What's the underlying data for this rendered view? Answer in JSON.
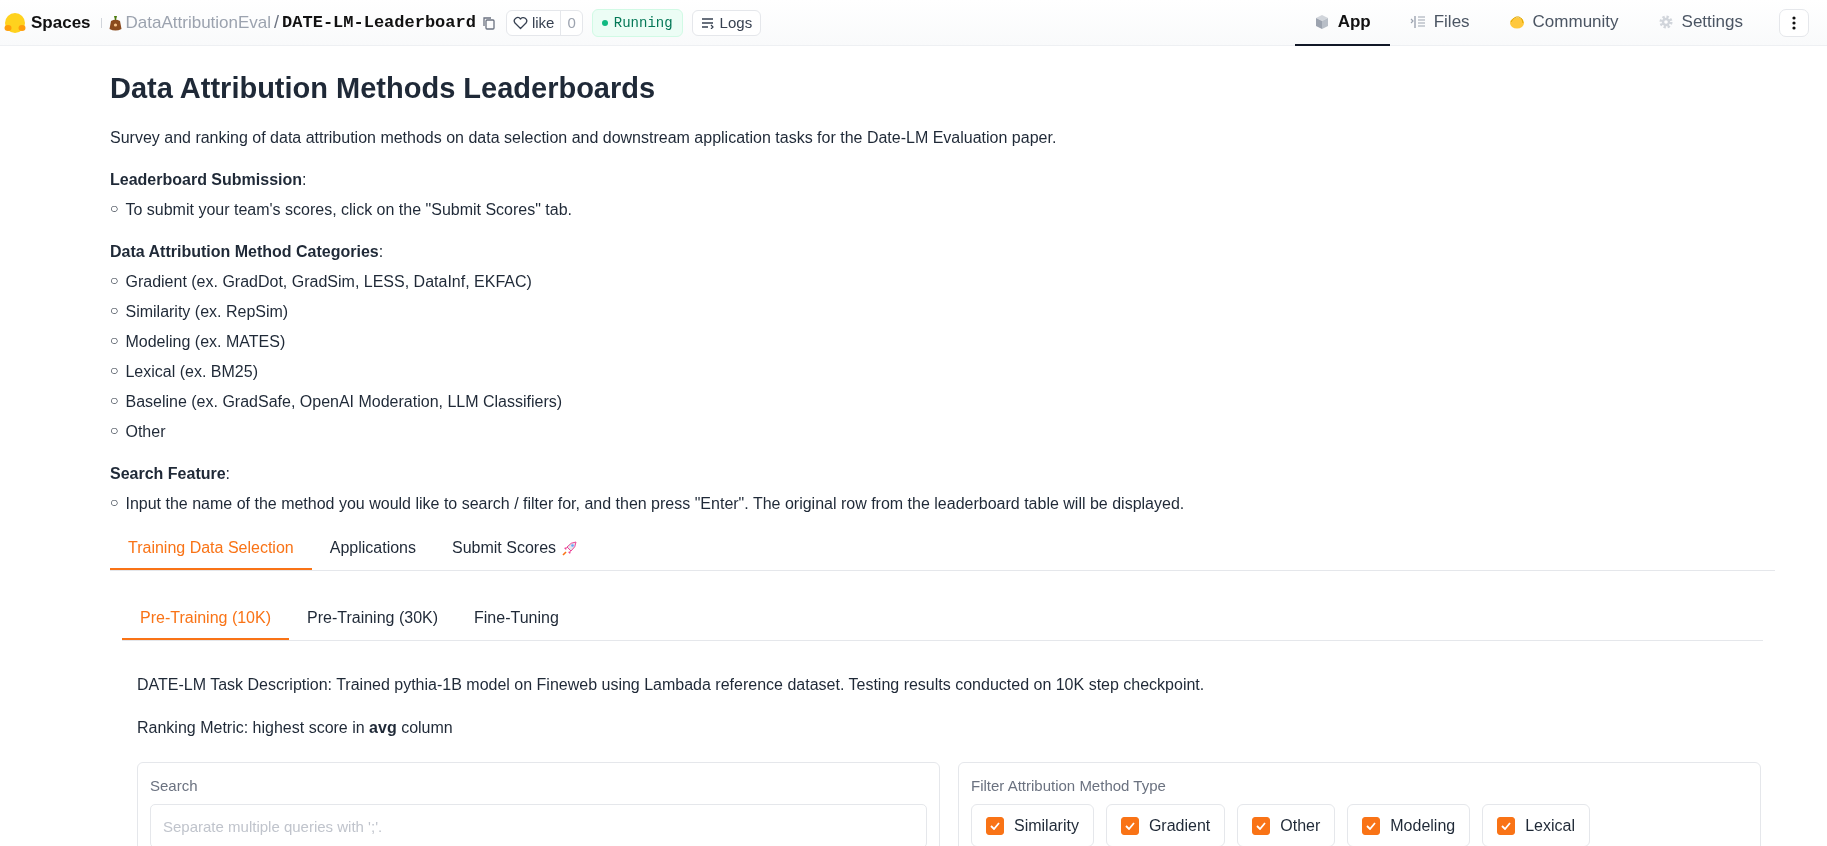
{
  "header": {
    "logo_text": "Spaces",
    "owner": "DataAttributionEval",
    "separator": "/",
    "repo": "DATE-LM-Leaderboard",
    "like": {
      "label": "like",
      "count": "0",
      "liked": false
    },
    "status": "Running",
    "logs": "Logs",
    "nav": [
      {
        "label": "App",
        "selected": true
      },
      {
        "label": "Files",
        "selected": false
      },
      {
        "label": "Community",
        "selected": false
      },
      {
        "label": "Settings",
        "selected": false
      }
    ]
  },
  "title": "Data Attribution Methods Leaderboards",
  "intro": "Survey and ranking of data attribution methods on data selection and downstream application tasks for the Date-LM Evaluation paper.",
  "sections": [
    {
      "heading": "Leaderboard Submission",
      "colon": ":",
      "items": [
        {
          "bullet": "○",
          "text": "To submit your team's scores, click on the \"Submit Scores\" tab."
        }
      ]
    },
    {
      "heading": "Data Attribution Method Categories",
      "colon": ":",
      "items": [
        {
          "bullet": "○",
          "text": "Gradient (ex. GradDot, GradSim, LESS, DataInf, EKFAC)"
        },
        {
          "bullet": "○",
          "text": "Similarity (ex. RepSim)"
        },
        {
          "bullet": "○",
          "text": "Modeling (ex. MATES)"
        },
        {
          "bullet": "○",
          "text": "Lexical (ex. BM25)"
        },
        {
          "bullet": "○",
          "text": "Baseline (ex. GradSafe, OpenAI Moderation, LLM Classifiers)"
        },
        {
          "bullet": "○",
          "text": "Other"
        }
      ]
    },
    {
      "heading": "Search Feature",
      "colon": ":",
      "items": [
        {
          "bullet": "○",
          "text": "Input the name of the method you would like to search / filter for, and then press \"Enter\". The original row from the leaderboard table will be displayed."
        }
      ]
    }
  ],
  "tabs": [
    {
      "label": "Training Data Selection",
      "selected": true
    },
    {
      "label": "Applications",
      "selected": false
    },
    {
      "label": "Submit Scores",
      "selected": false,
      "kind": "rocket"
    }
  ],
  "subtabs": [
    {
      "label": "Pre-Training (10K)",
      "selected": true
    },
    {
      "label": "Pre-Training (30K)",
      "selected": false
    },
    {
      "label": "Fine-Tuning",
      "selected": false
    }
  ],
  "task_description": "DATE-LM Task Description: Trained pythia-1B model on Fineweb using Lambada reference dataset. Testing results conducted on 10K step checkpoint.",
  "ranking_metric": "Ranking Metric: highest score in **avg** column",
  "search": {
    "label": "Search",
    "placeholder": "Separate multiple queries with ';'."
  },
  "filter": {
    "label": "Filter Attribution Method Type",
    "options": [
      {
        "label": "Similarity",
        "checked": true
      },
      {
        "label": "Gradient",
        "checked": true
      },
      {
        "label": "Other",
        "checked": true
      },
      {
        "label": "Modeling",
        "checked": true
      },
      {
        "label": "Lexical",
        "checked": true
      }
    ]
  }
}
